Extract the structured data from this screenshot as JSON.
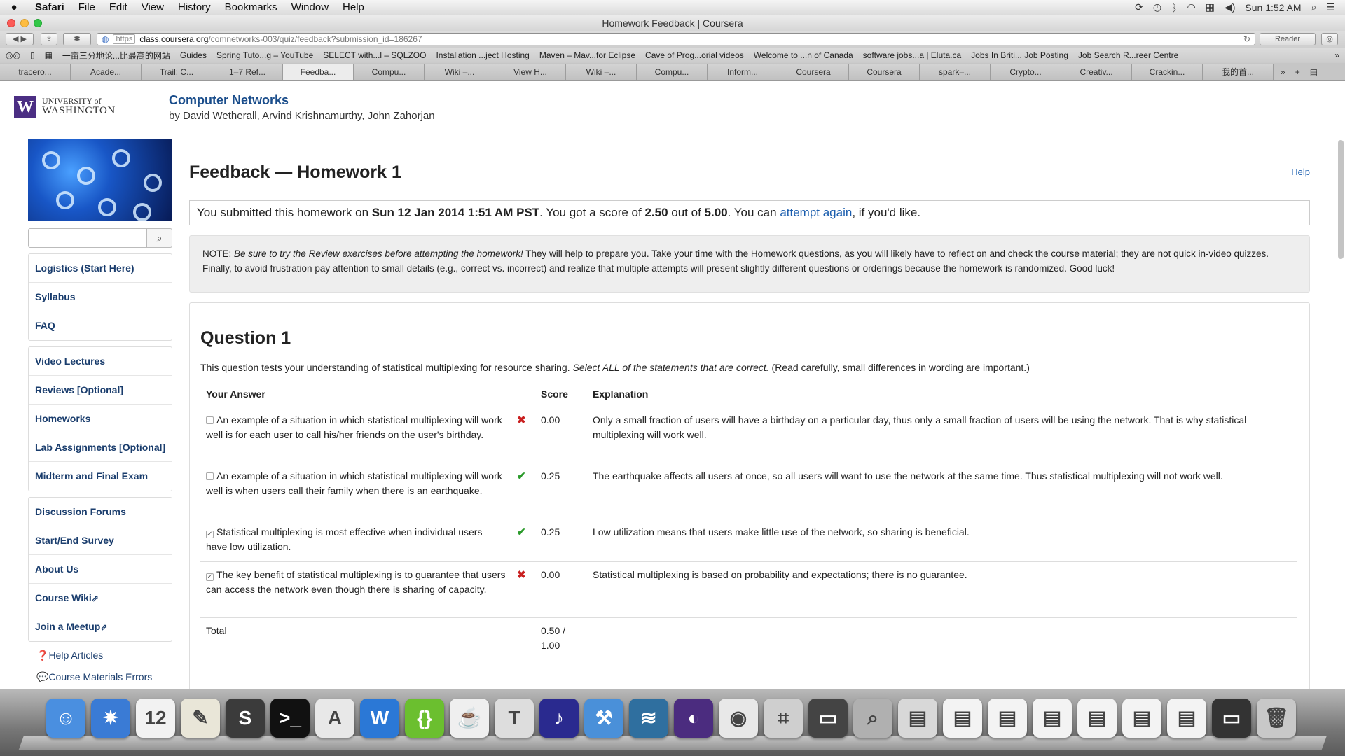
{
  "menubar": {
    "app": "Safari",
    "items": [
      "File",
      "Edit",
      "View",
      "History",
      "Bookmarks",
      "Window",
      "Help"
    ],
    "clock": "Sun 1:52 AM"
  },
  "window": {
    "title": "Homework Feedback | Coursera"
  },
  "toolbar": {
    "url_protocol": "https",
    "url_host": "class.coursera.org",
    "url_path": "/comnetworks-003/quiz/feedback?submission_id=186267",
    "reader_label": "Reader"
  },
  "bookmarks": [
    "一亩三分地论...比最高的网站",
    "Guides",
    "Spring Tuto...g – YouTube",
    "SELECT with...l – SQLZOO",
    "Installation ...ject Hosting",
    "Maven – Mav...for Eclipse",
    "Cave of Prog...orial videos",
    "Welcome to ...n of Canada",
    "software jobs...a | Eluta.ca",
    "Jobs In Briti... Job Posting",
    "Job Search R...reer Centre"
  ],
  "tabs": [
    "tracero...",
    "Acade...",
    "Trail: C...",
    "1–7 Ref...",
    "Feedba...",
    "Compu...",
    "Wiki –...",
    "View H...",
    "Wiki –...",
    "Compu...",
    "Inform...",
    "Coursera",
    "Coursera",
    "spark–...",
    "Crypto...",
    "Creativ...",
    "Crackin...",
    "我的首..."
  ],
  "site": {
    "uw_line1": "UNIVERSITY of",
    "uw_line2": "WASHINGTON",
    "course_title": "Computer Networks",
    "authors": "by David Wetherall, Arvind Krishnamurthy, John Zahorjan"
  },
  "sidebar": {
    "groups": [
      [
        "Logistics (Start Here)",
        "Syllabus",
        "FAQ"
      ],
      [
        "Video Lectures",
        "Reviews [Optional]",
        "Homeworks",
        "Lab Assignments [Optional]",
        "Midterm and Final Exam"
      ],
      [
        "Discussion Forums",
        "Start/End Survey",
        "About Us",
        "Course Wiki",
        "Join a Meetup"
      ]
    ],
    "links": [
      "Help Articles",
      "Course Materials Errors"
    ]
  },
  "main": {
    "title": "Feedback — Homework 1",
    "help": "Help",
    "score": {
      "p1": "You submitted this homework on ",
      "date": "Sun 12 Jan 2014 1:51 AM PST",
      "p2": ". You got a score of ",
      "score": "2.50",
      "p3": " out of ",
      "max": "5.00",
      "p4": ". You can ",
      "link": "attempt again",
      "p5": ", if you'd like."
    },
    "note": {
      "prefix": "NOTE: ",
      "italic": "Be sure to try the Review exercises before attempting the homework!",
      "rest": " They will help to prepare you. Take your time with the Homework questions, as you will likely have to reflect on and check the course material; they are not quick in-video quizzes. Finally, to avoid frustration pay attention to small details (e.g., correct vs. incorrect) and realize that multiple attempts will present slightly different questions or orderings because the homework is randomized. Good luck!"
    },
    "question": {
      "title": "Question 1",
      "desc_p1": "This question tests your understanding of statistical multiplexing for resource sharing. ",
      "desc_italic": "Select ALL of the statements that are correct.",
      "desc_p2": " (Read carefully, small differences in wording are important.)",
      "headers": {
        "answer": "Your Answer",
        "score": "Score",
        "explanation": "Explanation"
      },
      "rows": [
        {
          "checked": false,
          "answer": "An example of a situation in which statistical multiplexing will work well is for each user to call his/her friends on the user's birthday.",
          "correct": false,
          "score": "0.00",
          "explanation": "Only a small fraction of users will have a birthday on a particular day, thus only a small fraction of users will be using the network. That is why statistical multiplexing will work well."
        },
        {
          "checked": false,
          "answer": "An example of a situation in which statistical multiplexing will work well is when users call their family when there is an earthquake.",
          "correct": true,
          "score": "0.25",
          "explanation": "The earthquake affects all users at once, so all users will want to use the network at the same time. Thus statistical multiplexing will not work well."
        },
        {
          "checked": true,
          "answer": "Statistical multiplexing is most effective when individual users have low utilization.",
          "correct": true,
          "score": "0.25",
          "explanation": "Low utilization means that users make little use of the network, so sharing is beneficial."
        },
        {
          "checked": true,
          "answer": "The key benefit of statistical multiplexing is to guarantee that users can access the network even though there is sharing of capacity.",
          "correct": false,
          "score": "0.00",
          "explanation": "Statistical multiplexing is based on probability and expectations; there is no guarantee."
        }
      ],
      "total_label": "Total",
      "total_value": "0.50 / 1.00"
    }
  },
  "dock": {
    "icons": [
      {
        "name": "finder-icon",
        "color": "#4a8fe0",
        "glyph": "☺"
      },
      {
        "name": "safari-icon",
        "color": "#3a7bd5",
        "glyph": "✷"
      },
      {
        "name": "calendar-icon",
        "color": "#f2f2f2",
        "glyph": "12"
      },
      {
        "name": "textedit-icon",
        "color": "#e9e6d8",
        "glyph": "✎"
      },
      {
        "name": "sublime-text-icon",
        "color": "#3b3b3b",
        "glyph": "S"
      },
      {
        "name": "terminal-icon",
        "color": "#111111",
        "glyph": ">_"
      },
      {
        "name": "acrobat-icon",
        "color": "#e8e8e8",
        "glyph": "A"
      },
      {
        "name": "word-icon",
        "color": "#2b78d6",
        "glyph": "W"
      },
      {
        "name": "json-editor-icon",
        "color": "#6bbf2f",
        "glyph": "{}"
      },
      {
        "name": "java-icon",
        "color": "#efefef",
        "glyph": "☕"
      },
      {
        "name": "texshop-icon",
        "color": "#dddddd",
        "glyph": "T"
      },
      {
        "name": "audacity-icon",
        "color": "#2a2a8f",
        "glyph": "♪"
      },
      {
        "name": "xcode-icon",
        "color": "#4a90d9",
        "glyph": "⚒"
      },
      {
        "name": "mysql-workbench-icon",
        "color": "#2f6f9f",
        "glyph": "≋"
      },
      {
        "name": "eclipse-icon",
        "color": "#4b2c7f",
        "glyph": "◐"
      },
      {
        "name": "chrome-icon",
        "color": "#e8e8e8",
        "glyph": "◉"
      },
      {
        "name": "calculator-icon",
        "color": "#cfcfcf",
        "glyph": "⌗"
      },
      {
        "name": "keynote-icon",
        "color": "#444444",
        "glyph": "▭"
      },
      {
        "name": "preview-icon",
        "color": "#b0b0b0",
        "glyph": "⌕"
      },
      {
        "name": "documents-folder-icon",
        "color": "#d8d8d8",
        "glyph": "▤"
      },
      {
        "name": "pdf-document-icon",
        "color": "#f3f3f3",
        "glyph": "▤"
      },
      {
        "name": "word-document-icon",
        "color": "#f3f3f3",
        "glyph": "▤"
      },
      {
        "name": "pdf-document-icon",
        "color": "#f3f3f3",
        "glyph": "▤"
      },
      {
        "name": "pdf-document-icon",
        "color": "#f3f3f3",
        "glyph": "▤"
      },
      {
        "name": "pdf-document-icon",
        "color": "#f3f3f3",
        "glyph": "▤"
      },
      {
        "name": "text-document-icon",
        "color": "#f3f3f3",
        "glyph": "▤"
      },
      {
        "name": "minimized-window-icon",
        "color": "#333333",
        "glyph": "▭"
      },
      {
        "name": "trash-icon",
        "color": "#c8c8c8",
        "glyph": "🗑"
      }
    ]
  },
  "colors": {
    "link": "#1a5dae",
    "nav": "#1a3d6d",
    "uw_purple": "#4b2e83",
    "wrong": "#c91f1f",
    "right": "#2a9a2a"
  }
}
